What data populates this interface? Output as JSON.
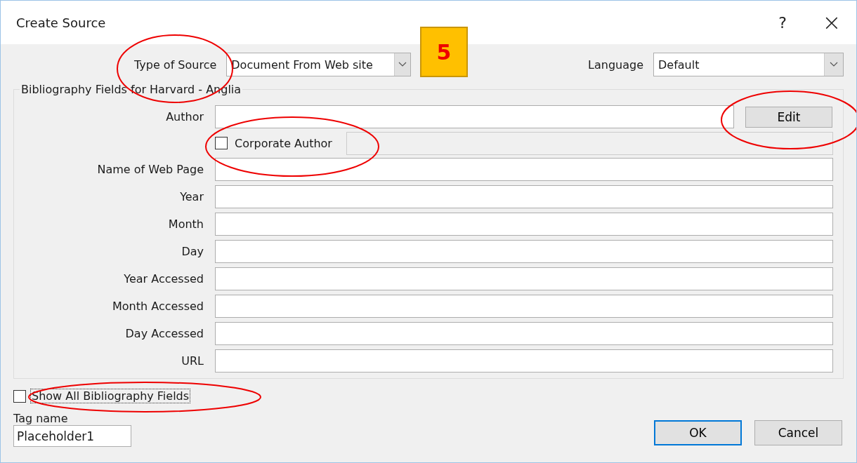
{
  "window": {
    "title": "Create Source",
    "help": "?",
    "close": "×"
  },
  "type_of_source": {
    "label": "Type of Source",
    "value": "Document From Web site"
  },
  "language": {
    "label": "Language",
    "value": "Default"
  },
  "badge": "5",
  "group": {
    "title": "Bibliography Fields for Harvard - Anglia",
    "author": {
      "label": "Author",
      "edit_button": "Edit"
    },
    "corporate_author": {
      "label": "Corporate Author",
      "checked": false
    },
    "fields": [
      {
        "label": "Name of Web Page"
      },
      {
        "label": "Year"
      },
      {
        "label": "Month"
      },
      {
        "label": "Day"
      },
      {
        "label": "Year Accessed"
      },
      {
        "label": "Month Accessed"
      },
      {
        "label": "Day Accessed"
      },
      {
        "label": "URL"
      }
    ]
  },
  "show_all": {
    "label": "Show All Bibliography Fields",
    "checked": false
  },
  "tag_name": {
    "label": "Tag name",
    "value": "Placeholder1"
  },
  "buttons": [
    {
      "label": "OK",
      "default": true
    },
    {
      "label": "Cancel",
      "default": false
    }
  ]
}
